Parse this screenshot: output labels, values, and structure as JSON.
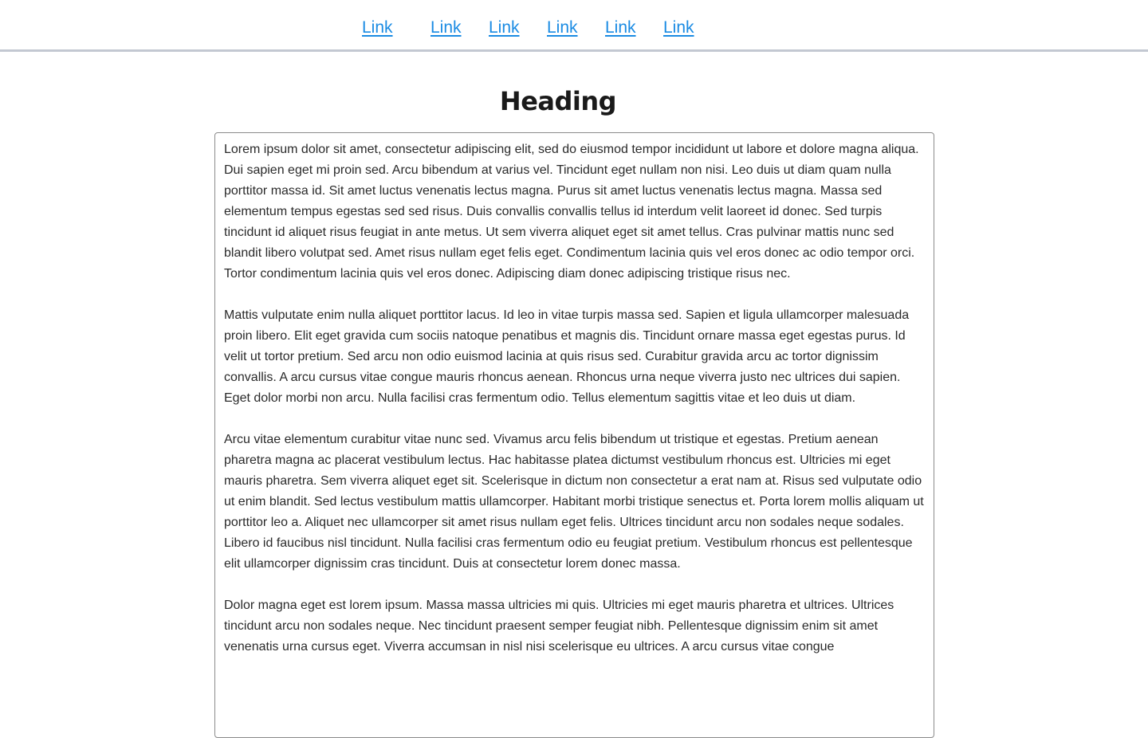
{
  "nav": {
    "links": [
      "Link",
      "Link",
      "Link",
      "Link",
      "Link",
      "Link"
    ]
  },
  "main": {
    "heading": "Heading",
    "paragraphs": [
      "Lorem ipsum dolor sit amet, consectetur adipiscing elit, sed do eiusmod tempor incididunt ut labore et dolore magna aliqua. Dui sapien eget mi proin sed. Arcu bibendum at varius vel. Tincidunt eget nullam non nisi. Leo duis ut diam quam nulla porttitor massa id. Sit amet luctus venenatis lectus magna. Purus sit amet luctus venenatis lectus magna. Massa sed elementum tempus egestas sed sed risus. Duis convallis convallis tellus id interdum velit laoreet id donec. Sed turpis tincidunt id aliquet risus feugiat in ante metus. Ut sem viverra aliquet eget sit amet tellus. Cras pulvinar mattis nunc sed blandit libero volutpat sed. Amet risus nullam eget felis eget. Condimentum lacinia quis vel eros donec ac odio tempor orci. Tortor condimentum lacinia quis vel eros donec. Adipiscing diam donec adipiscing tristique risus nec.",
      "Mattis vulputate enim nulla aliquet porttitor lacus. Id leo in vitae turpis massa sed. Sapien et ligula ullamcorper malesuada proin libero. Elit eget gravida cum sociis natoque penatibus et magnis dis. Tincidunt ornare massa eget egestas purus. Id velit ut tortor pretium. Sed arcu non odio euismod lacinia at quis risus sed. Curabitur gravida arcu ac tortor dignissim convallis. A arcu cursus vitae congue mauris rhoncus aenean. Rhoncus urna neque viverra justo nec ultrices dui sapien. Eget dolor morbi non arcu. Nulla facilisi cras fermentum odio. Tellus elementum sagittis vitae et leo duis ut diam.",
      "Arcu vitae elementum curabitur vitae nunc sed. Vivamus arcu felis bibendum ut tristique et egestas. Pretium aenean pharetra magna ac placerat vestibulum lectus. Hac habitasse platea dictumst vestibulum rhoncus est. Ultricies mi eget mauris pharetra. Sem viverra aliquet eget sit. Scelerisque in dictum non consectetur a erat nam at. Risus sed vulputate odio ut enim blandit. Sed lectus vestibulum mattis ullamcorper. Habitant morbi tristique senectus et. Porta lorem mollis aliquam ut porttitor leo a. Aliquet nec ullamcorper sit amet risus nullam eget felis. Ultrices tincidunt arcu non sodales neque sodales. Libero id faucibus nisl tincidunt. Nulla facilisi cras fermentum odio eu feugiat pretium. Vestibulum rhoncus est pellentesque elit ullamcorper dignissim cras tincidunt. Duis at consectetur lorem donec massa.",
      "Dolor magna eget est lorem ipsum. Massa massa ultricies mi quis. Ultricies mi eget mauris pharetra et ultrices. Ultrices tincidunt arcu non sodales neque. Nec tincidunt praesent semper feugiat nibh. Pellentesque dignissim enim sit amet venenatis urna cursus eget. Viverra accumsan in nisl nisi scelerisque eu ultrices. A arcu cursus vitae congue"
    ]
  },
  "colors": {
    "link": "#1a8be3",
    "header_border": "#c3c8d2",
    "text": "#2a2a2a",
    "box_border": "#8b8b8b"
  }
}
